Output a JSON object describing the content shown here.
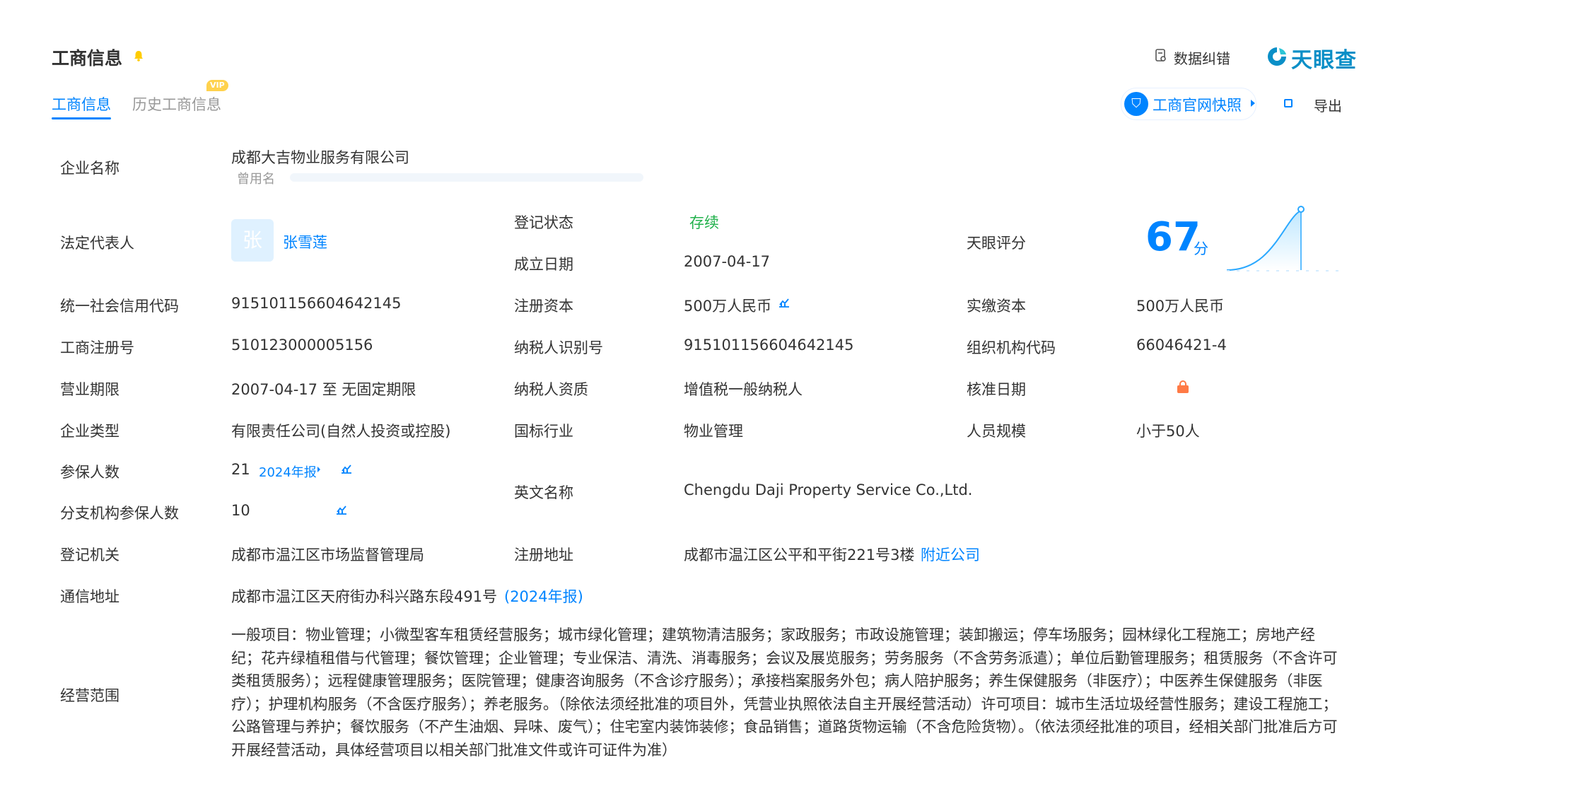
{
  "header": {
    "title": "工商信息",
    "tabs": [
      {
        "label": "工商信息",
        "active": true
      },
      {
        "label": "历史工商信息",
        "badge": "VIP"
      }
    ],
    "data_correction": "数据纠错",
    "brand": "天眼查",
    "snapshot": "工商官网快照",
    "export": "导出"
  },
  "company": {
    "name_label": "企业名称",
    "name": "成都大吉物业服务有限公司",
    "former_label": "曾用名",
    "legal_rep_label": "法定代表人",
    "legal_rep_avatar": "张",
    "legal_rep": "张雪莲",
    "reg_status_label": "登记状态",
    "reg_status": "存续",
    "found_date_label": "成立日期",
    "found_date": "2007-04-17",
    "score_label": "天眼评分",
    "score": "67",
    "score_unit": "分",
    "credit_code_label": "统一社会信用代码",
    "credit_code": "915101156604642145",
    "reg_capital_label": "注册资本",
    "reg_capital": "500万人民币",
    "paid_capital_label": "实缴资本",
    "paid_capital": "500万人民币",
    "reg_no_label": "工商注册号",
    "reg_no": "510123000005156",
    "taxpayer_id_label": "纳税人识别号",
    "taxpayer_id": "915101156604642145",
    "org_code_label": "组织机构代码",
    "org_code": "66046421-4",
    "term_label": "营业期限",
    "term": "2007-04-17 至 无固定期限",
    "taxpayer_qual_label": "纳税人资质",
    "taxpayer_qual": "增值税一般纳税人",
    "approve_date_label": "核准日期",
    "type_label": "企业类型",
    "type": "有限责任公司(自然人投资或控股)",
    "industry_label": "国标行业",
    "industry": "物业管理",
    "staff_size_label": "人员规模",
    "staff_size": "小于50人",
    "insured_label": "参保人数",
    "insured": "21",
    "insured_report": "2024年报",
    "branch_insured_label": "分支机构参保人数",
    "branch_insured": "10",
    "english_name_label": "英文名称",
    "english_name": "Chengdu Daji Property Service Co.,Ltd.",
    "authority_label": "登记机关",
    "authority": "成都市温江区市场监督管理局",
    "reg_address_label": "注册地址",
    "reg_address": "成都市温江区公平和平街221号3楼",
    "nearby": "附近公司",
    "mail_address_label": "通信地址",
    "mail_address": "成都市温江区天府街办科兴路东段491号",
    "mail_report": "(2024年报)",
    "scope_label": "经营范围",
    "scope": "一般项目：物业管理；小微型客车租赁经营服务；城市绿化管理；建筑物清洁服务；家政服务；市政设施管理；装卸搬运；停车场服务；园林绿化工程施工；房地产经纪；花卉绿植租借与代管理；餐饮管理；企业管理；专业保洁、清洗、消毒服务；会议及展览服务；劳务服务（不含劳务派遣）；单位后勤管理服务；租赁服务（不含许可类租赁服务）；远程健康管理服务；医院管理；健康咨询服务（不含诊疗服务）；承接档案服务外包；病人陪护服务；养生保健服务（非医疗）；中医养生保健服务（非医疗）；护理机构服务（不含医疗服务）；养老服务。（除依法须经批准的项目外，凭营业执照依法自主开展经营活动）许可项目：城市生活垃圾经营性服务；建设工程施工；公路管理与养护；餐饮服务（不产生油烟、异味、废气）；住宅室内装饰装修；食品销售；道路货物运输（不含危险货物）。（依法须经批准的项目，经相关部门批准后方可开展经营活动，具体经营项目以相关部门批准文件或许可证件为准）"
  },
  "colors": {
    "accent": "#0084ff",
    "status_green": "#22b14c",
    "vip": "#ffd24d"
  }
}
